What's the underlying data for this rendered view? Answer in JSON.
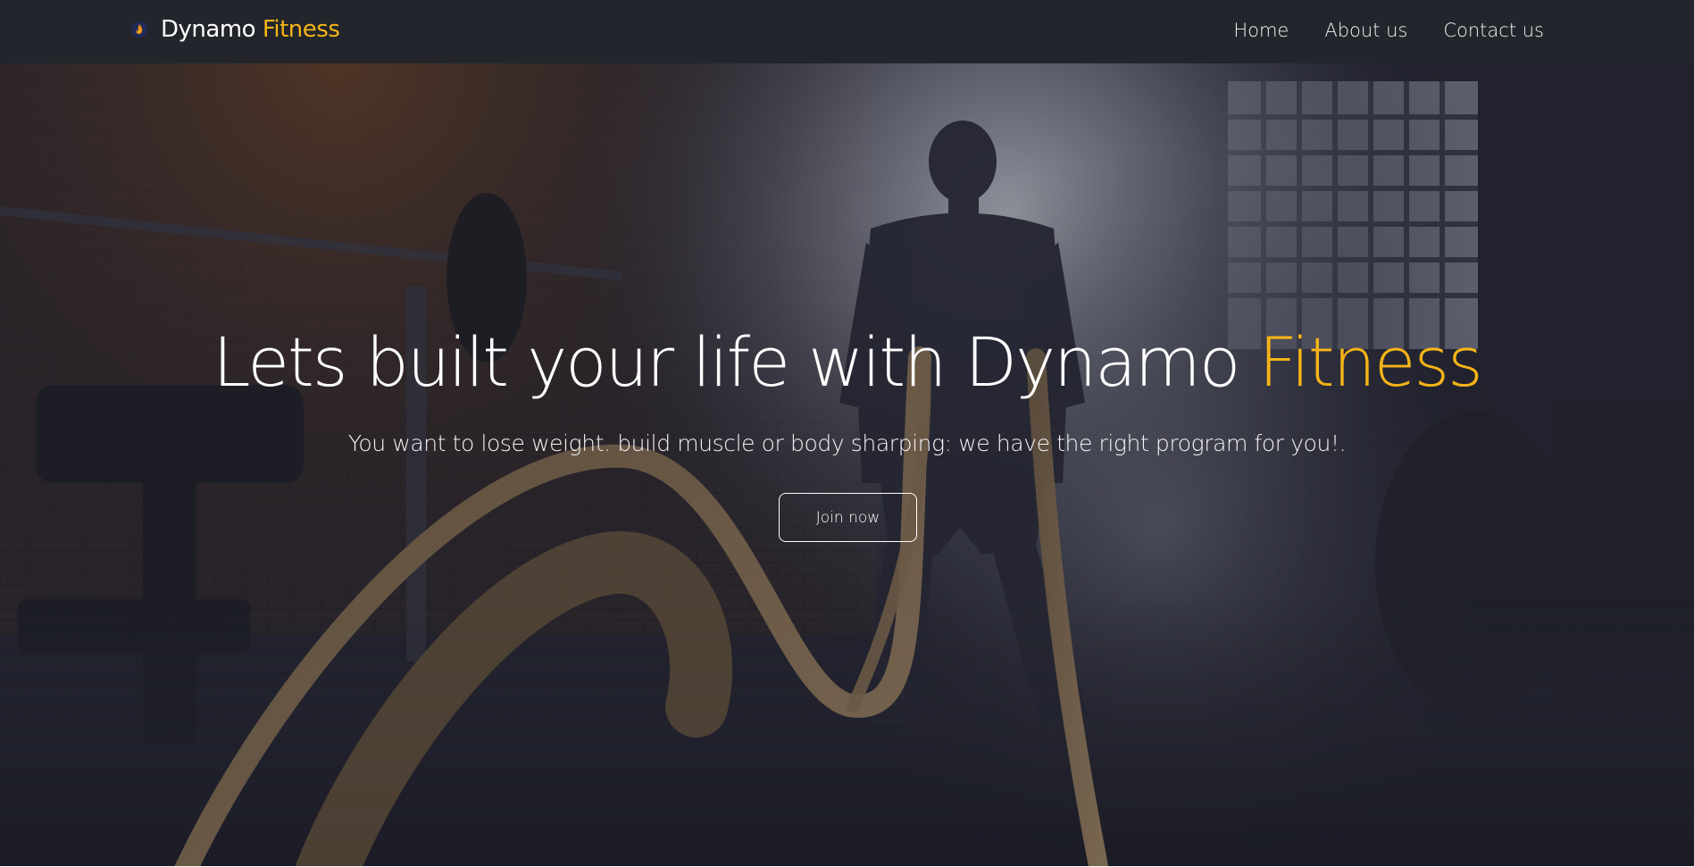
{
  "brand": {
    "name": "Dynamo",
    "accent": "Fitness",
    "logo_icon": "flame-logo-icon"
  },
  "nav": {
    "items": [
      {
        "label": "Home"
      },
      {
        "label": "About us"
      },
      {
        "label": "Contact us"
      }
    ]
  },
  "hero": {
    "title_main": "Lets built your life with Dynamo ",
    "title_accent": "Fitness",
    "subtitle": "You want to lose weight. build muscle or body sharping: we have the right program for you!.",
    "cta_label": "Join now"
  },
  "colors": {
    "accent": "#f5b417",
    "navbar_bg": "#22252b",
    "text": "#ffffff"
  }
}
